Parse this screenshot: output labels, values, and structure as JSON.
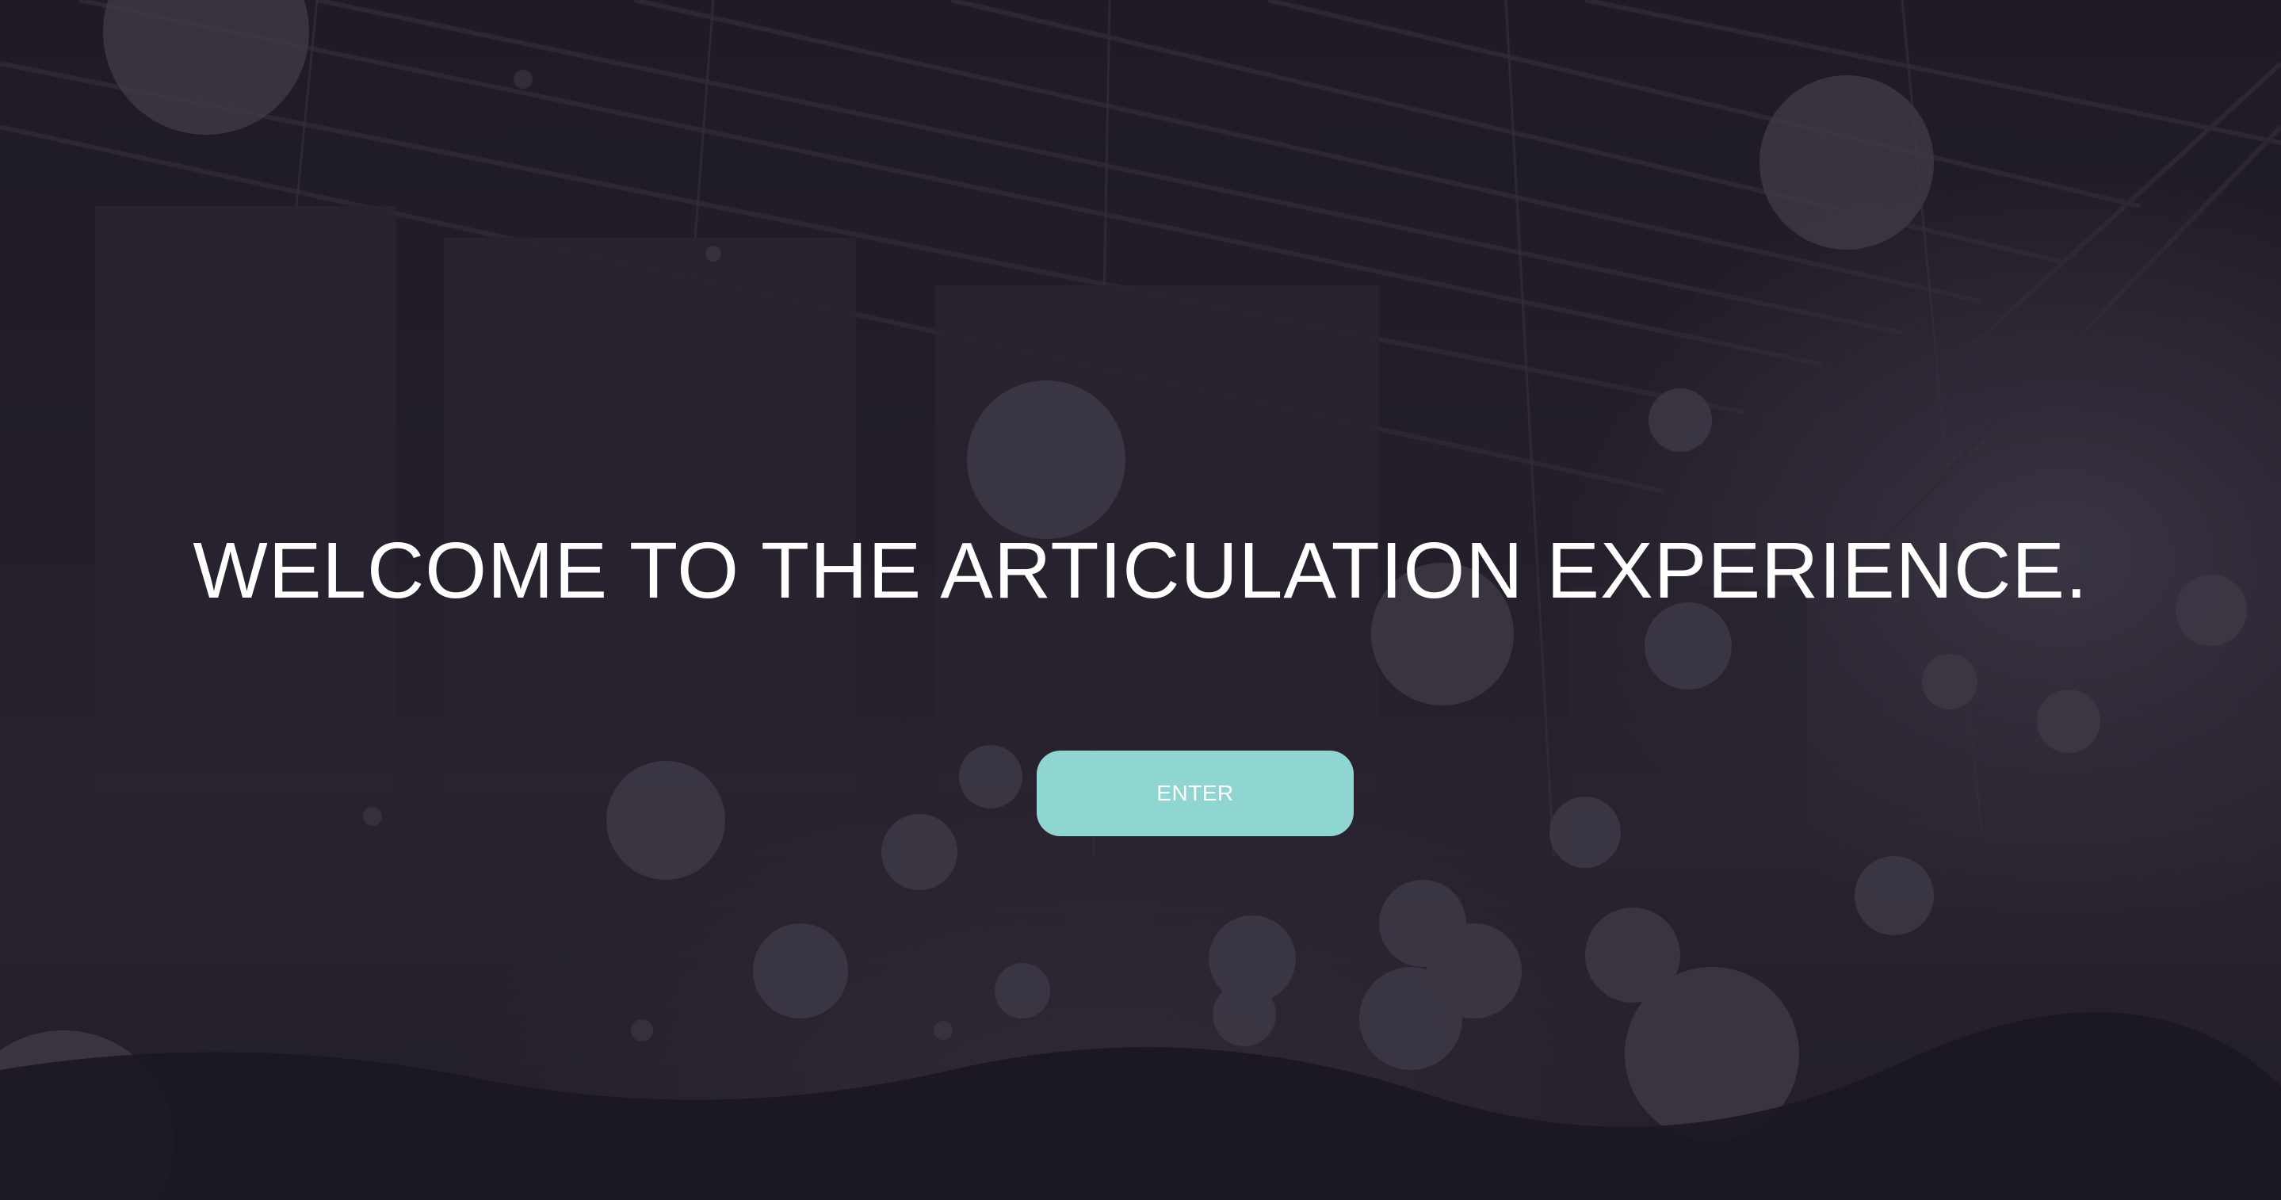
{
  "hero": {
    "headline": "WELCOME TO THE ARTICULATION EXPERIENCE.",
    "enter_label": "ENTER",
    "background_image": "concert-crowd-photo"
  },
  "colors": {
    "background": "#1e1a24",
    "button": "#8fd6d3",
    "text": "#ffffff"
  }
}
